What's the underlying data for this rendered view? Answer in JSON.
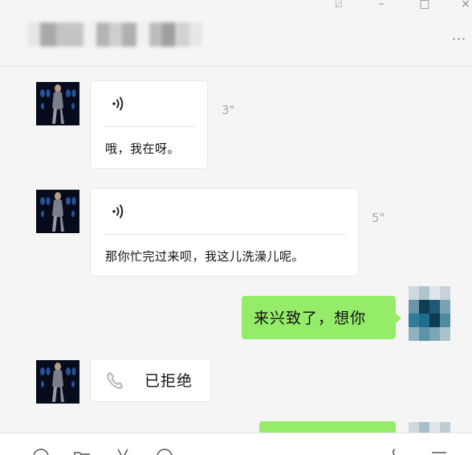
{
  "window": {
    "pin_glyph": "⍁",
    "min_glyph": "–",
    "max_glyph": "□",
    "close_glyph": "×"
  },
  "header": {
    "more_glyph": "···"
  },
  "messages": [
    {
      "side": "left",
      "type": "voice",
      "text": "哦，我在呀。",
      "duration": "3\""
    },
    {
      "side": "left",
      "type": "voice",
      "text": "那你忙完过来呗，我这儿洗澡儿呢。",
      "duration": "5\""
    },
    {
      "side": "right",
      "type": "text",
      "text": "来兴致了，想你"
    },
    {
      "side": "left",
      "type": "call",
      "text": "已拒绝"
    }
  ],
  "colors": {
    "sent_bubble": "#95ec69",
    "received_bubble": "#ffffff",
    "background": "#f5f5f5"
  },
  "icons": [
    "pin-icon",
    "minimize-icon",
    "maximize-icon",
    "close-icon",
    "more-icon",
    "voice-wave-icon",
    "phone-icon",
    "emoji-icon",
    "folder-icon",
    "scissors-icon",
    "chat-history-icon",
    "call-icon",
    "video-icon"
  ]
}
